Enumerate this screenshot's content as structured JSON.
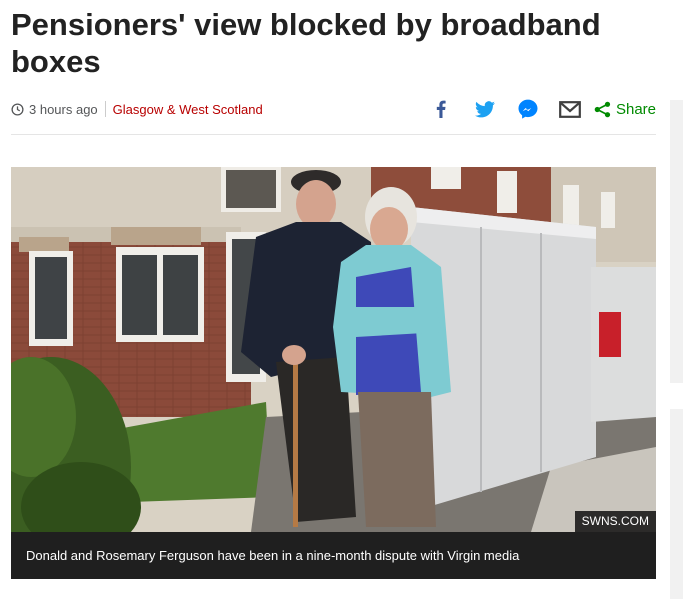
{
  "article": {
    "headline": "Pensioners' view blocked by broadband boxes",
    "timestamp": "3 hours ago",
    "section": "Glasgow & West Scotland"
  },
  "share": {
    "facebook_icon": "facebook-icon",
    "twitter_icon": "twitter-icon",
    "messenger_icon": "messenger-icon",
    "email_icon": "email-icon",
    "share_label": "Share"
  },
  "image": {
    "credit": "SWNS.COM",
    "caption": "Donald and Rosemary Ferguson have been in a nine-month dispute with Virgin media"
  },
  "colors": {
    "section_link": "#b80000",
    "share_green": "#008a00",
    "facebook": "#3b5998",
    "twitter": "#1da1f2",
    "messenger": "#0084ff"
  }
}
